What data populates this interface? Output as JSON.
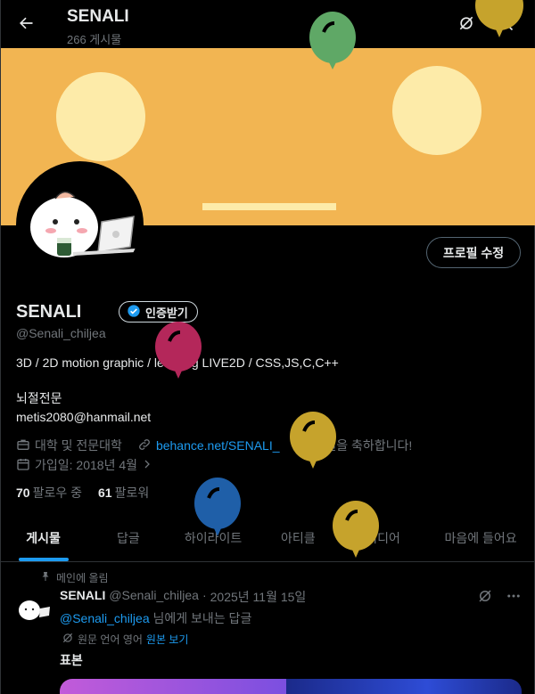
{
  "header": {
    "title": "SENALI",
    "post_count": "266 게시물",
    "back_icon": "arrow-left-icon",
    "grok_icon": "grok-icon",
    "search_icon": "search-icon"
  },
  "banner": {
    "color": "#f2b552",
    "accent": "#fdeba9"
  },
  "profile": {
    "edit_label": "프로필 수정",
    "name": "SENALI",
    "verify_label": "인증받기",
    "handle": "@Senali_chiljea",
    "bio_line1": "3D / 2D motion graphic / learning LIVE2D / CSS,JS,C,C++",
    "bio_line2": "뇌절전문",
    "bio_line3": "metis2080@hanmail.net",
    "profession": "대학 및 전문대학",
    "website": "behance.net/SENALI_",
    "birthday": "생일을 축하합니다!",
    "joined": "가입일: 2018년 4월",
    "following_count": "70",
    "following_label": "팔로우 중",
    "followers_count": "61",
    "followers_label": "팔로워"
  },
  "tabs": [
    {
      "label": "게시물",
      "active": true
    },
    {
      "label": "답글",
      "active": false
    },
    {
      "label": "하이라이트",
      "active": false
    },
    {
      "label": "아티클",
      "active": false
    },
    {
      "label": "미디어",
      "active": false
    },
    {
      "label": "마음에 들어요",
      "active": false
    }
  ],
  "post": {
    "pinned_label": "메인에 올림",
    "author": "SENALI",
    "handle": "@Senali_chiljea",
    "separator": "·",
    "date": "2025년 11월 15일",
    "reply_to": "@Senali_chiljea",
    "reply_suffix": "님에게 보내는 답글",
    "translate_prefix": "원문 언어 영어",
    "translate_link": "원본 보기",
    "text": "표본"
  },
  "colors": {
    "accent_blue": "#1d9bf0",
    "balloon_green": "#5fa866",
    "balloon_gold": "#c6a32c",
    "balloon_magenta": "#b4275a",
    "balloon_blue": "#1f5fa8"
  }
}
